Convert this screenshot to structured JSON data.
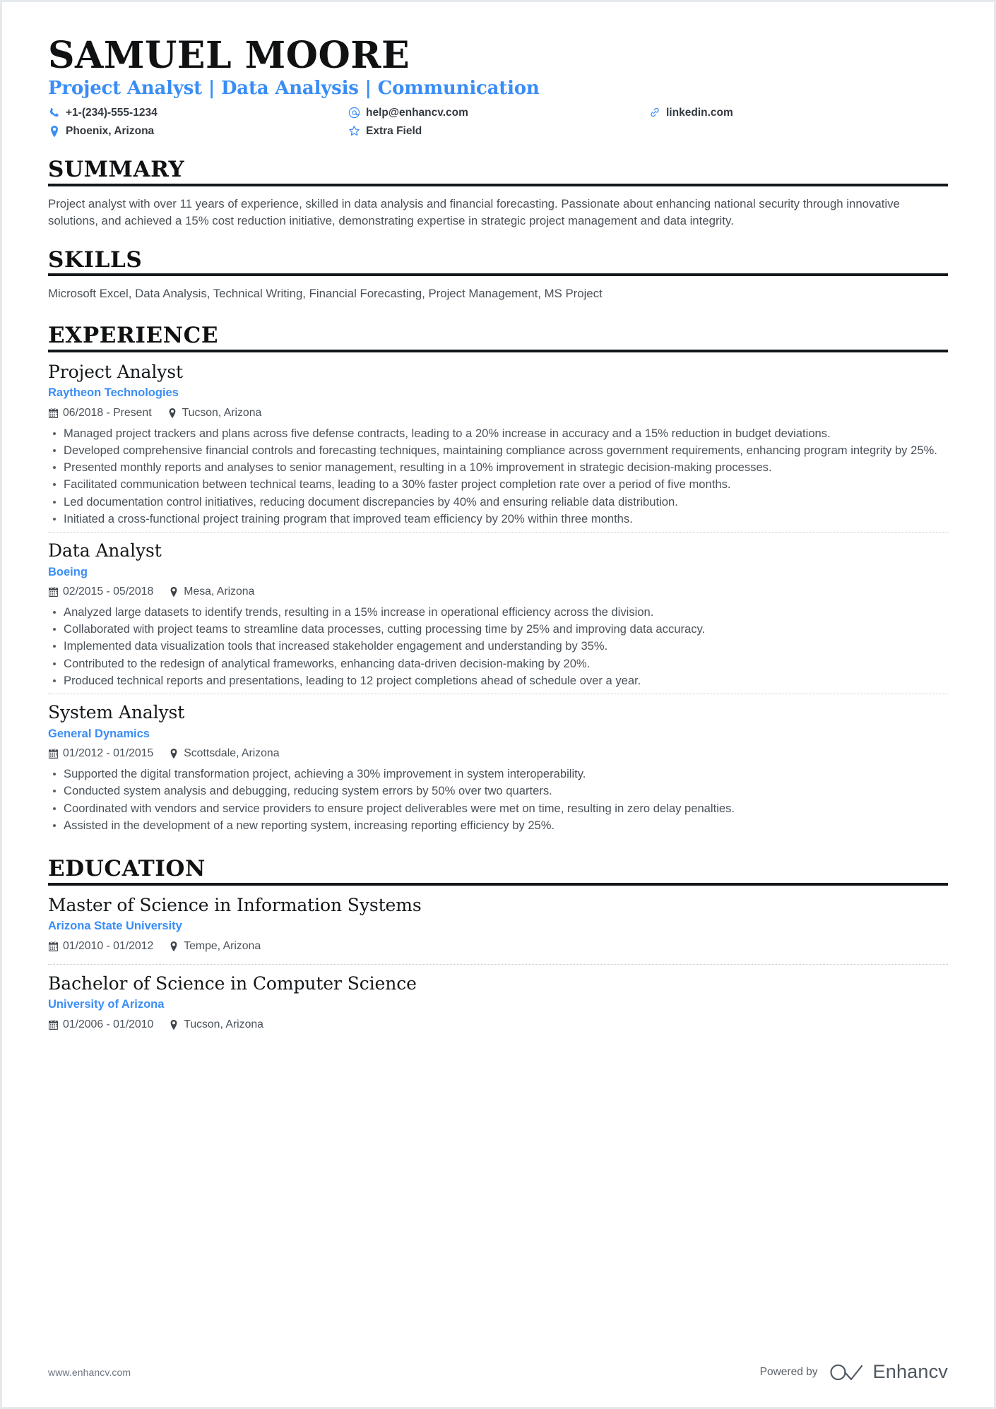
{
  "header": {
    "name": "SAMUEL MOORE",
    "headline": "Project Analyst | Data Analysis | Communication",
    "contacts": [
      {
        "icon": "phone-icon",
        "text": "+1-(234)-555-1234"
      },
      {
        "icon": "email-icon",
        "text": "help@enhancv.com"
      },
      {
        "icon": "link-icon",
        "text": "linkedin.com"
      },
      {
        "icon": "location-icon",
        "text": "Phoenix, Arizona"
      },
      {
        "icon": "star-icon",
        "text": "Extra Field"
      }
    ]
  },
  "sections": {
    "summary": {
      "heading": "SUMMARY",
      "text": "Project analyst with over 11 years of experience, skilled in data analysis and financial forecasting. Passionate about enhancing national security through innovative solutions, and achieved a 15% cost reduction initiative, demonstrating expertise in strategic project management and data integrity."
    },
    "skills": {
      "heading": "SKILLS",
      "text": "Microsoft Excel, Data Analysis, Technical Writing, Financial Forecasting, Project Management, MS Project"
    },
    "experience": {
      "heading": "EXPERIENCE",
      "entries": [
        {
          "title": "Project Analyst",
          "org": "Raytheon Technologies",
          "dates": "06/2018 - Present",
          "location": "Tucson, Arizona",
          "bullets": [
            "Managed project trackers and plans across five defense contracts, leading to a 20% increase in accuracy and a 15% reduction in budget deviations.",
            "Developed comprehensive financial controls and forecasting techniques, maintaining compliance across government requirements, enhancing program integrity by 25%.",
            "Presented monthly reports and analyses to senior management, resulting in a 10% improvement in strategic decision-making processes.",
            "Facilitated communication between technical teams, leading to a 30% faster project completion rate over a period of five months.",
            "Led documentation control initiatives, reducing document discrepancies by 40% and ensuring reliable data distribution.",
            "Initiated a cross-functional project training program that improved team efficiency by 20% within three months."
          ]
        },
        {
          "title": "Data Analyst",
          "org": "Boeing",
          "dates": "02/2015 - 05/2018",
          "location": "Mesa, Arizona",
          "bullets": [
            "Analyzed large datasets to identify trends, resulting in a 15% increase in operational efficiency across the division.",
            "Collaborated with project teams to streamline data processes, cutting processing time by 25% and improving data accuracy.",
            "Implemented data visualization tools that increased stakeholder engagement and understanding by 35%.",
            "Contributed to the redesign of analytical frameworks, enhancing data-driven decision-making by 20%.",
            "Produced technical reports and presentations, leading to 12 project completions ahead of schedule over a year."
          ]
        },
        {
          "title": "System Analyst",
          "org": "General Dynamics",
          "dates": "01/2012 - 01/2015",
          "location": "Scottsdale, Arizona",
          "bullets": [
            "Supported the digital transformation project, achieving a 30% improvement in system interoperability.",
            "Conducted system analysis and debugging, reducing system errors by 50% over two quarters.",
            "Coordinated with vendors and service providers to ensure project deliverables were met on time, resulting in zero delay penalties.",
            "Assisted in the development of a new reporting system, increasing reporting efficiency by 25%."
          ]
        }
      ]
    },
    "education": {
      "heading": "EDUCATION",
      "entries": [
        {
          "title": "Master of Science in Information Systems",
          "org": "Arizona State University",
          "dates": "01/2010 - 01/2012",
          "location": "Tempe, Arizona"
        },
        {
          "title": "Bachelor of Science in Computer Science",
          "org": "University of Arizona",
          "dates": "01/2006 - 01/2010",
          "location": "Tucson, Arizona"
        }
      ]
    }
  },
  "footer": {
    "url": "www.enhancv.com",
    "powered_by": "Powered by",
    "brand": "Enhancv"
  },
  "colors": {
    "accent": "#3a8df5",
    "text": "#4a5158",
    "heading": "#14171a"
  }
}
